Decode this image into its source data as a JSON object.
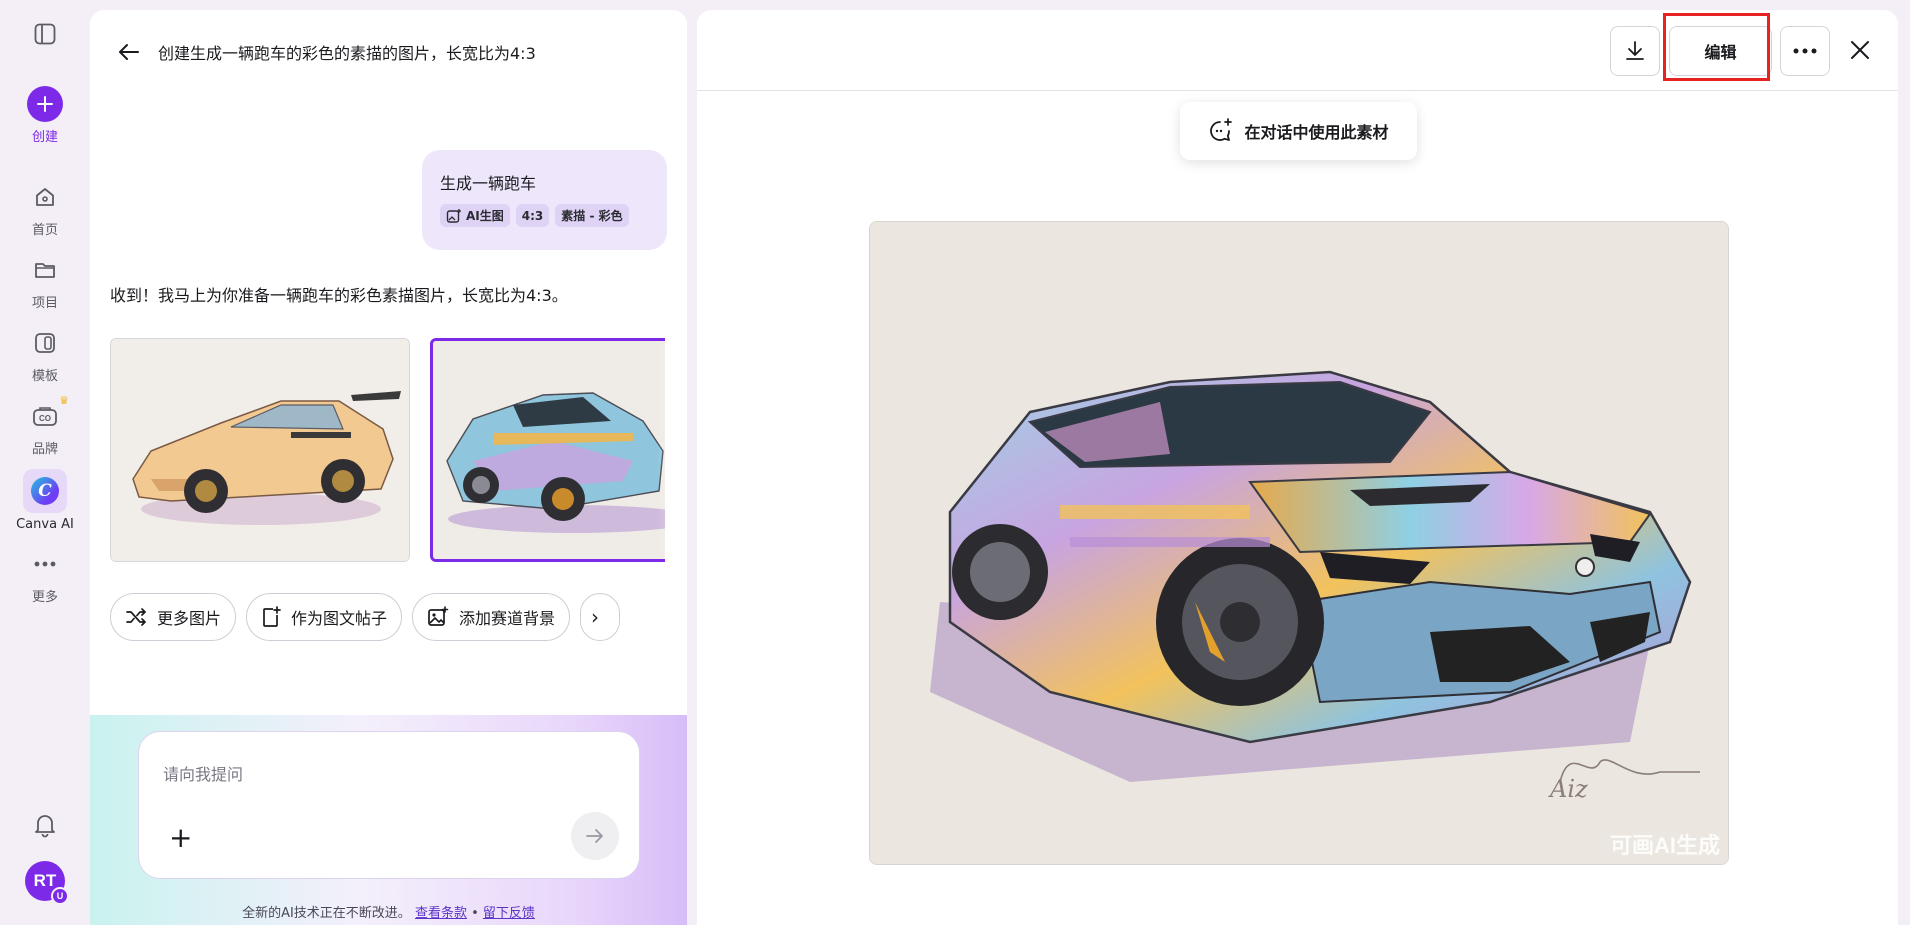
{
  "rail": {
    "create_label": "创建",
    "items": [
      {
        "label": "首页",
        "icon": "home-icon"
      },
      {
        "label": "项目",
        "icon": "folder-icon"
      },
      {
        "label": "模板",
        "icon": "template-icon"
      },
      {
        "label": "品牌",
        "icon": "brand-icon"
      },
      {
        "label": "Canva AI",
        "icon": "canva-ai-icon"
      },
      {
        "label": "更多",
        "icon": "more-icon"
      }
    ],
    "avatar_initials": "RT",
    "avatar_badge": "U"
  },
  "chat": {
    "title": "创建生成一辆跑车的彩色的素描的图片，长宽比为4:3",
    "user_message": "生成一辆跑车",
    "chips": [
      "AI生图",
      "4:3",
      "素描 - 彩色"
    ],
    "reply": "收到！我马上为你准备一辆跑车的彩色素描图片，长宽比为4:3。",
    "actions": [
      "更多图片",
      "作为图文帖子",
      "添加赛道背景"
    ],
    "prompt_placeholder": "请向我提问",
    "footer_text": "全新的AI技术正在不断改进。",
    "footer_terms": "查看条款",
    "footer_sep": "•",
    "footer_feedback": "留下反馈"
  },
  "preview": {
    "edit_label": "编辑",
    "use_in_chat_label": "在对话中使用此素材",
    "watermark": "可画AI生成",
    "signature": "Aiz"
  },
  "colors": {
    "brand_purple": "#7d2ae8",
    "highlight_red": "#e52323"
  }
}
